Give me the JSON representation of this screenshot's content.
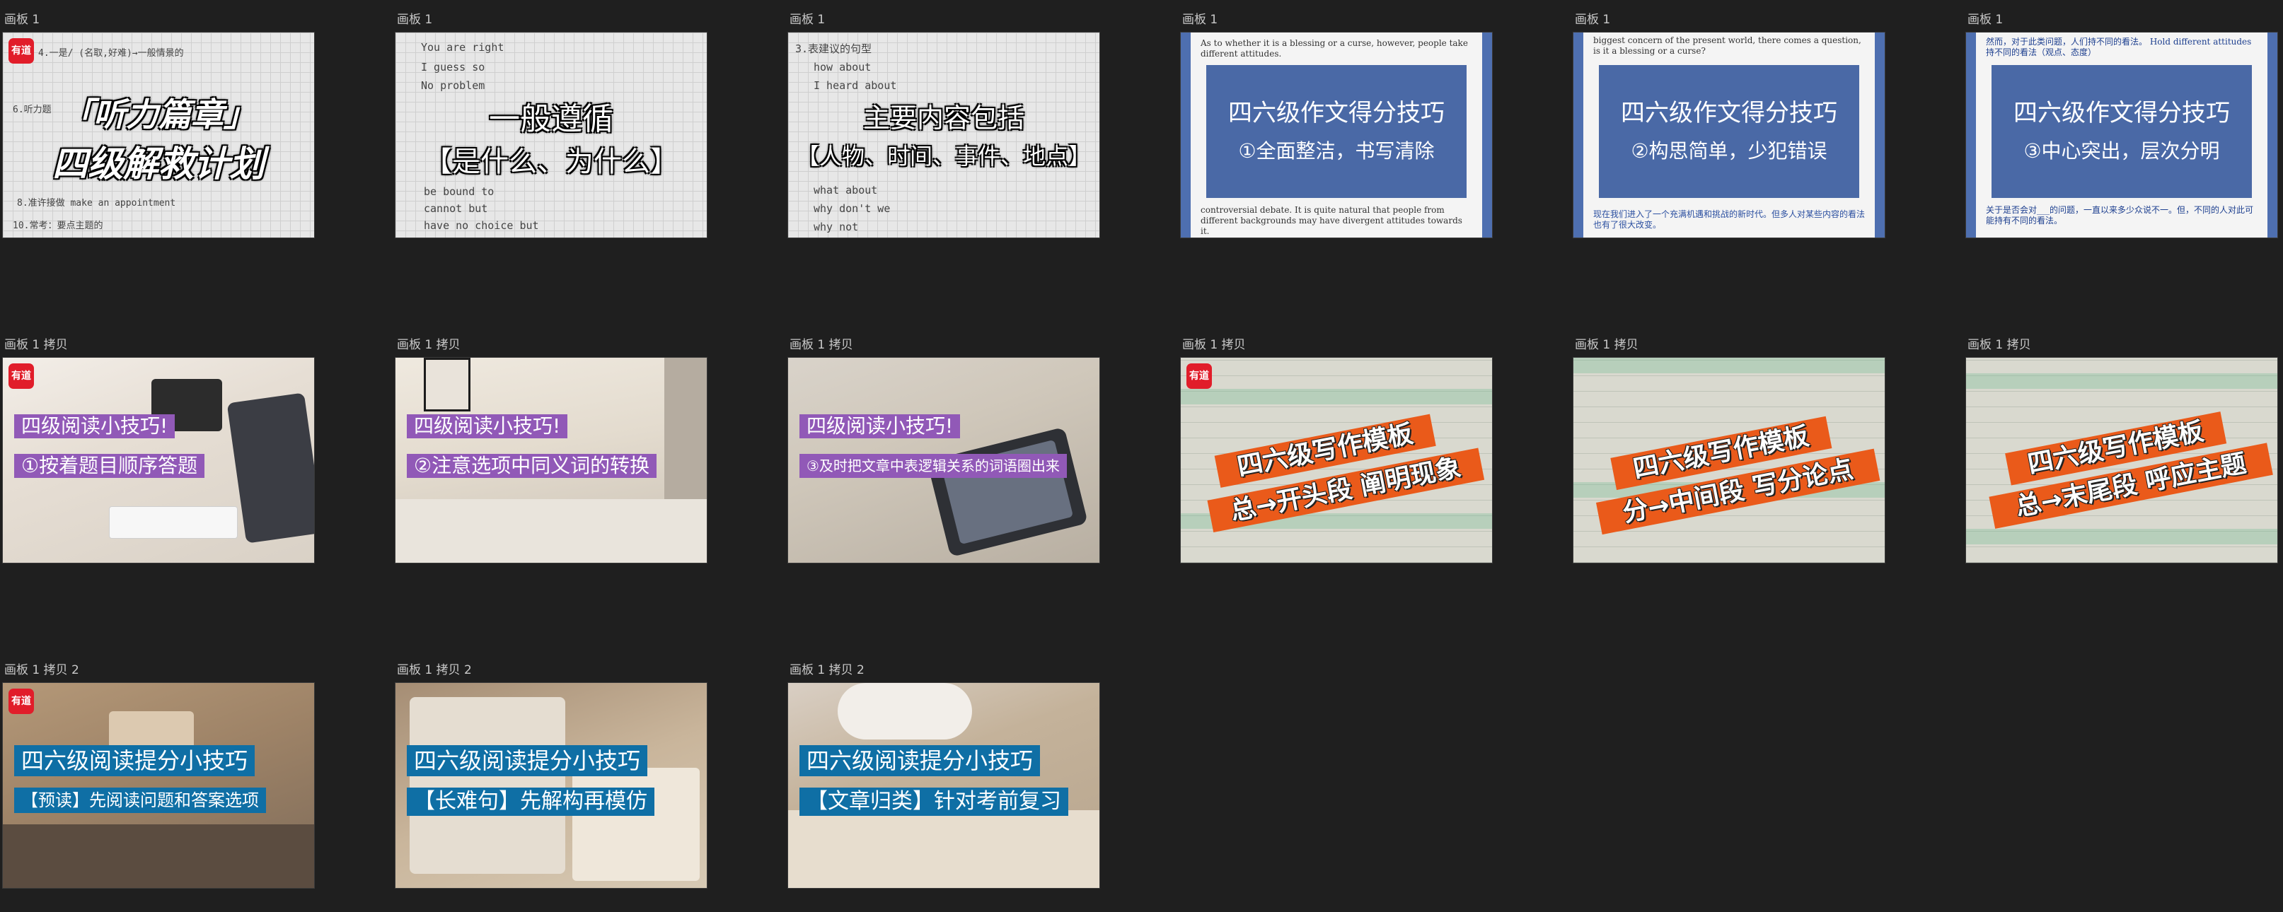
{
  "boards": [
    {
      "label": "画板 1",
      "logo": "有道",
      "title1": "「听力篇章」",
      "title2": "四级解救计划",
      "notes": [
        "4.一是/ (名取,好难)→一般情景的",
        "6.听力题",
        "10.常考：要点主题的",
        "8.准许接做 make an appointment"
      ]
    },
    {
      "label": "画板 1",
      "title1": "一般遵循",
      "title2": "【是什么、为什么】",
      "notes": [
        "You are right",
        "I guess so",
        "No problem",
        "be bound to",
        "cannot but",
        "have no choice but"
      ]
    },
    {
      "label": "画板 1",
      "title1": "主要内容包括",
      "title2": "【人物、时间、事件、地点】",
      "notes": [
        "3.表建议的句型",
        "how about",
        "I heard about",
        "what about",
        "why don't we",
        "why not"
      ]
    },
    {
      "label": "画板 1",
      "title1": "四六级作文得分技巧",
      "title2": "①全面整洁，书写清除",
      "doc_top": "As to whether it is a blessing or a curse, however, people take different attitudes.",
      "doc_bottom": "controversial debate. It is quite natural that people from different backgrounds may have divergent attitudes towards it."
    },
    {
      "label": "画板 1",
      "title1": "四六级作文得分技巧",
      "title2": "②构思简单，少犯错误",
      "doc_top": "biggest concern of the present world, there comes a question, is it a blessing or a curse?",
      "doc_bottom": "现在我们进入了一个充满机遇和挑战的新时代。但多人对某些内容的看法也有了很大改变。"
    },
    {
      "label": "画板 1",
      "title1": "四六级作文得分技巧",
      "title2": "③中心突出，层次分明",
      "doc_top": "然而，对于此类问题，人们持不同的看法。 Hold different attitudes持不同的看法（观点、态度）",
      "doc_bottom": "关于是否会对___的问题，一直以来多少众说不一。但，不同的人对此可能持有不同的看法。"
    },
    {
      "label": "画板 1 拷贝",
      "logo": "有道",
      "title1": "四级阅读小技巧!",
      "title2": "①按着题目顺序答题"
    },
    {
      "label": "画板 1 拷贝",
      "title1": "四级阅读小技巧!",
      "title2": "②注意选项中同义词的转换"
    },
    {
      "label": "画板 1 拷贝",
      "title1": "四级阅读小技巧!",
      "title2": "③及时把文章中表逻辑关系的词语圈出来"
    },
    {
      "label": "画板 1 拷贝",
      "logo": "有道",
      "title1": "四六级写作模板",
      "title2": "总→开头段 阐明现象"
    },
    {
      "label": "画板 1 拷贝",
      "title1": "四六级写作模板",
      "title2": "分→中间段 写分论点"
    },
    {
      "label": "画板 1 拷贝",
      "title1": "四六级写作模板",
      "title2": "总→末尾段 呼应主题"
    },
    {
      "label": "画板 1 拷贝 2",
      "logo": "有道",
      "title1": "四六级阅读提分小技巧",
      "title2": "【预读】先阅读问题和答案选项"
    },
    {
      "label": "画板 1 拷贝 2",
      "title1": "四六级阅读提分小技巧",
      "title2": "【长难句】先解构再模仿"
    },
    {
      "label": "画板 1 拷贝 2",
      "title1": "四六级阅读提分小技巧",
      "title2": "【文章归类】针对考前复习"
    }
  ],
  "colors": {
    "canvas": "#1f1f1f",
    "logo_red": "#e11d2a",
    "doc_blue": "#4a69a6",
    "purple": "#9159b7",
    "orange": "#ea5a1a",
    "bar_blue": "#0f6fa5"
  }
}
